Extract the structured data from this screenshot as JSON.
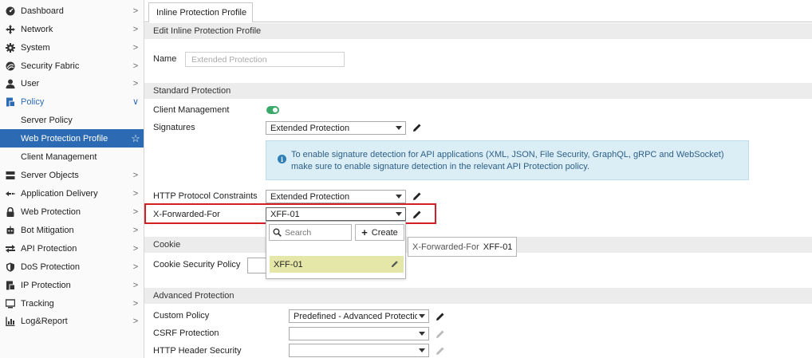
{
  "sidebar": {
    "items": [
      {
        "label": "Dashboard",
        "icon": "dashboard-icon",
        "chevron": ">"
      },
      {
        "label": "Network",
        "icon": "network-icon",
        "chevron": ">"
      },
      {
        "label": "System",
        "icon": "gear-icon",
        "chevron": ">"
      },
      {
        "label": "Security Fabric",
        "icon": "security-fabric-icon",
        "chevron": ">"
      },
      {
        "label": "User",
        "icon": "user-icon",
        "chevron": ">"
      },
      {
        "label": "Policy",
        "icon": "policy-icon",
        "chevron": "∨"
      },
      {
        "label": "Server Policy"
      },
      {
        "label": "Web Protection Profile",
        "star": "☆"
      },
      {
        "label": "Client Management"
      },
      {
        "label": "Server Objects",
        "icon": "server-icon",
        "chevron": ">"
      },
      {
        "label": "Application Delivery",
        "icon": "application-delivery-icon",
        "chevron": ">"
      },
      {
        "label": "Web Protection",
        "icon": "lock-icon",
        "chevron": ">"
      },
      {
        "label": "Bot Mitigation",
        "icon": "bot-icon",
        "chevron": ">"
      },
      {
        "label": "API Protection",
        "icon": "api-icon",
        "chevron": ">"
      },
      {
        "label": "DoS Protection",
        "icon": "shield-icon",
        "chevron": ">"
      },
      {
        "label": "IP Protection",
        "icon": "ip-protection-icon",
        "chevron": ">"
      },
      {
        "label": "Tracking",
        "icon": "tracking-icon",
        "chevron": ">"
      },
      {
        "label": "Log&Report",
        "icon": "log-report-icon",
        "chevron": ">"
      }
    ]
  },
  "tab": {
    "label": "Inline Protection Profile"
  },
  "sections": {
    "edit": "Edit Inline Protection Profile",
    "standard": "Standard Protection",
    "cookie": "Cookie",
    "advanced": "Advanced Protection"
  },
  "form": {
    "name_label": "Name",
    "name_placeholder": "Extended Protection",
    "client_management_label": "Client Management",
    "client_management_on": true,
    "signatures_label": "Signatures",
    "signatures_value": "Extended Protection",
    "info_text": "To enable signature detection for API applications (XML, JSON, File Security, GraphQL, gRPC and WebSocket) make sure to enable signature detection in the relevant API Protection policy.",
    "http_constraints_label": "HTTP Protocol Constraints",
    "http_constraints_value": "Extended Protection",
    "xff_label": "X-Forwarded-For",
    "xff_value": "XFF-01",
    "cookie_policy_label": "Cookie Security Policy",
    "custom_policy_label": "Custom Policy",
    "custom_policy_value": "Predefined - Advanced Protectio",
    "csrf_label": "CSRF Protection",
    "csrf_value": "",
    "header_security_label": "HTTP Header Security",
    "header_security_value": ""
  },
  "dropdown": {
    "search_placeholder": "Search",
    "create_label": "Create",
    "items": [
      "XFF-01"
    ]
  },
  "tooltip": {
    "label": "X-Forwarded-For",
    "value": "XFF-01"
  },
  "colors": {
    "active_nav": "#2c6bb3",
    "highlight_border": "#d0202a",
    "selected_item": "#e5e7a8",
    "info_bg": "#dbeef6",
    "toggle_on": "#3aaa6a"
  }
}
